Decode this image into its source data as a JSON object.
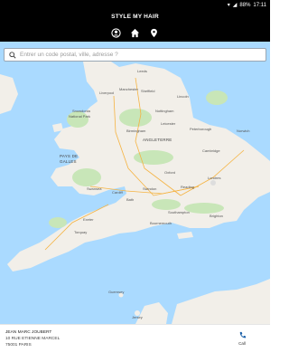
{
  "status_bar": {
    "battery": "88%",
    "time": "17:11"
  },
  "header": {
    "title": "STYLE MY HAIR"
  },
  "nav": [
    "profile-icon",
    "home-icon",
    "location-pin-icon"
  ],
  "search": {
    "placeholder": "Entrer un code postal, ville, adresse ?"
  },
  "map": {
    "labels": {
      "leeds": "Leeds",
      "liverpool": "Liverpool",
      "manchester": "Manchester",
      "sheffield": "Sheffield",
      "lincoln": "Lincoln",
      "nottingham": "Nottingham",
      "snowdonia": "Snowdonia",
      "national_park": "National Park",
      "leicester": "Leicester",
      "angleterre": "ANGLETERRE",
      "peterborough": "Peterborough",
      "norwich": "Norwich",
      "birmingham": "Birmingham",
      "cambridge": "Cambridge",
      "pays_de": "PAYS DE",
      "galles": "GALLES",
      "oxford": "Oxford",
      "london": "Londres",
      "swansea": "Swansea",
      "cardiff": "Cardiff",
      "bath": "Bath",
      "swindon": "Swindon",
      "reading": "Reading",
      "exeter": "Exeter",
      "torquay": "Torquay",
      "southampton": "Southampton",
      "brighton": "Brighton",
      "bournemouth": "Bournemouth",
      "guernsey": "Guernsey",
      "jersey": "Jersey"
    }
  },
  "salon": {
    "name": "JEAN MARC JOUBERT",
    "address": "10 RUE ETIENNE MARCEL",
    "city": "75001 PARIS",
    "call_label": "Call"
  },
  "colors": {
    "header_bg": "#000000",
    "sea": "#aadaff",
    "land": "#f2efe9",
    "park": "#c8e6b8",
    "accent": "#1a73e8"
  }
}
